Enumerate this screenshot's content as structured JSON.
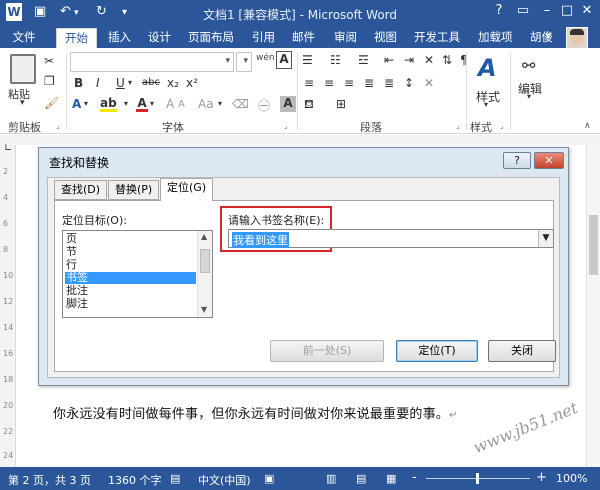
{
  "titlebar": {
    "title": "文档1 [兼容模式] - Microsoft Word",
    "help": "?"
  },
  "tabs": [
    "文件",
    "开始",
    "插入",
    "设计",
    "页面布局",
    "引用",
    "邮件",
    "审阅",
    "视图",
    "开发工具",
    "加载项"
  ],
  "user": "胡俊",
  "ribbon": {
    "paste": "粘贴",
    "groups": {
      "clipboard": "剪贴板",
      "font": "字体",
      "paragraph": "段落",
      "styles": "样式",
      "editing": "编辑"
    },
    "styles_btn": "样式",
    "editing_btn": "编辑",
    "font_buttons": [
      "B",
      "I",
      "U",
      "abc",
      "x₂",
      "x²"
    ],
    "font_size_small": "wén"
  },
  "dialog": {
    "title": "查找和替换",
    "help": "?",
    "tabs": [
      "查找(D)",
      "替换(P)",
      "定位(G)"
    ],
    "target_label": "定位目标(O):",
    "list_items": [
      "页",
      "节",
      "行",
      "书签",
      "批注",
      "脚注"
    ],
    "selected_item": "书签",
    "input_label": "请输入书签名称(E):",
    "input_value": "我看到这里",
    "buttons": {
      "prev": "前一处(S)",
      "goto": "定位(T)",
      "close": "关闭"
    }
  },
  "document": {
    "text": "你永远没有时间做每件事，但你永远有时间做对你来说最重要的事。",
    "ruler_numbers": [
      "2",
      "4",
      "6",
      "8",
      "10",
      "12",
      "14",
      "16",
      "18",
      "20",
      "22",
      "24"
    ]
  },
  "statusbar": {
    "page": "第 2 页，共 3 页",
    "words": "1360 个字",
    "language": "中文(中国)",
    "zoom": "100%",
    "minus": "-",
    "plus": "+"
  },
  "watermark": "www.jb51.net",
  "colors": {
    "accent": "#2b579a",
    "selection": "#3399ff",
    "highlight_box": "#d8262b"
  }
}
